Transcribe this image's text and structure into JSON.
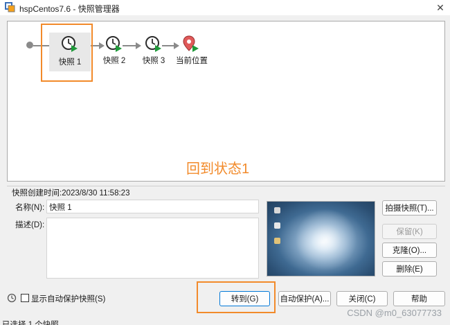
{
  "window": {
    "title": "hspCentos7.6 - 快照管理器",
    "app_icon": "vmware-icon",
    "close_glyph": "✕"
  },
  "tree": {
    "nodes": [
      {
        "label": "快照 1",
        "icon": "snapshot-clock-icon",
        "selected": true
      },
      {
        "label": "快照 2",
        "icon": "snapshot-clock-icon",
        "selected": false
      },
      {
        "label": "快照 3",
        "icon": "snapshot-clock-icon",
        "selected": false
      },
      {
        "label": "当前位置",
        "icon": "current-location-pin-icon",
        "selected": false
      }
    ],
    "annotation": "回到状态1"
  },
  "details": {
    "created_label": "快照创建时间:2023/8/30 11:58:23",
    "name_label": "名称(N):",
    "name_value": "快照 1",
    "description_label": "描述(D):",
    "description_value": ""
  },
  "side_buttons": {
    "take": "拍摄快照(T)...",
    "keep": "保留(K)",
    "clone": "克隆(O)...",
    "delete": "删除(E)"
  },
  "bottom": {
    "checkbox_label": "显示自动保护快照(S)",
    "goto": "转到(G)",
    "autoprotect": "自动保护(A)...",
    "close": "关闭(C)",
    "help": "帮助"
  },
  "status": "已选择 1 个快照",
  "watermark": "CSDN @m0_63077733",
  "colors": {
    "annotation": "#f28a2a",
    "clock_green": "#1f9a3a",
    "pin_red": "#e05a5a"
  }
}
